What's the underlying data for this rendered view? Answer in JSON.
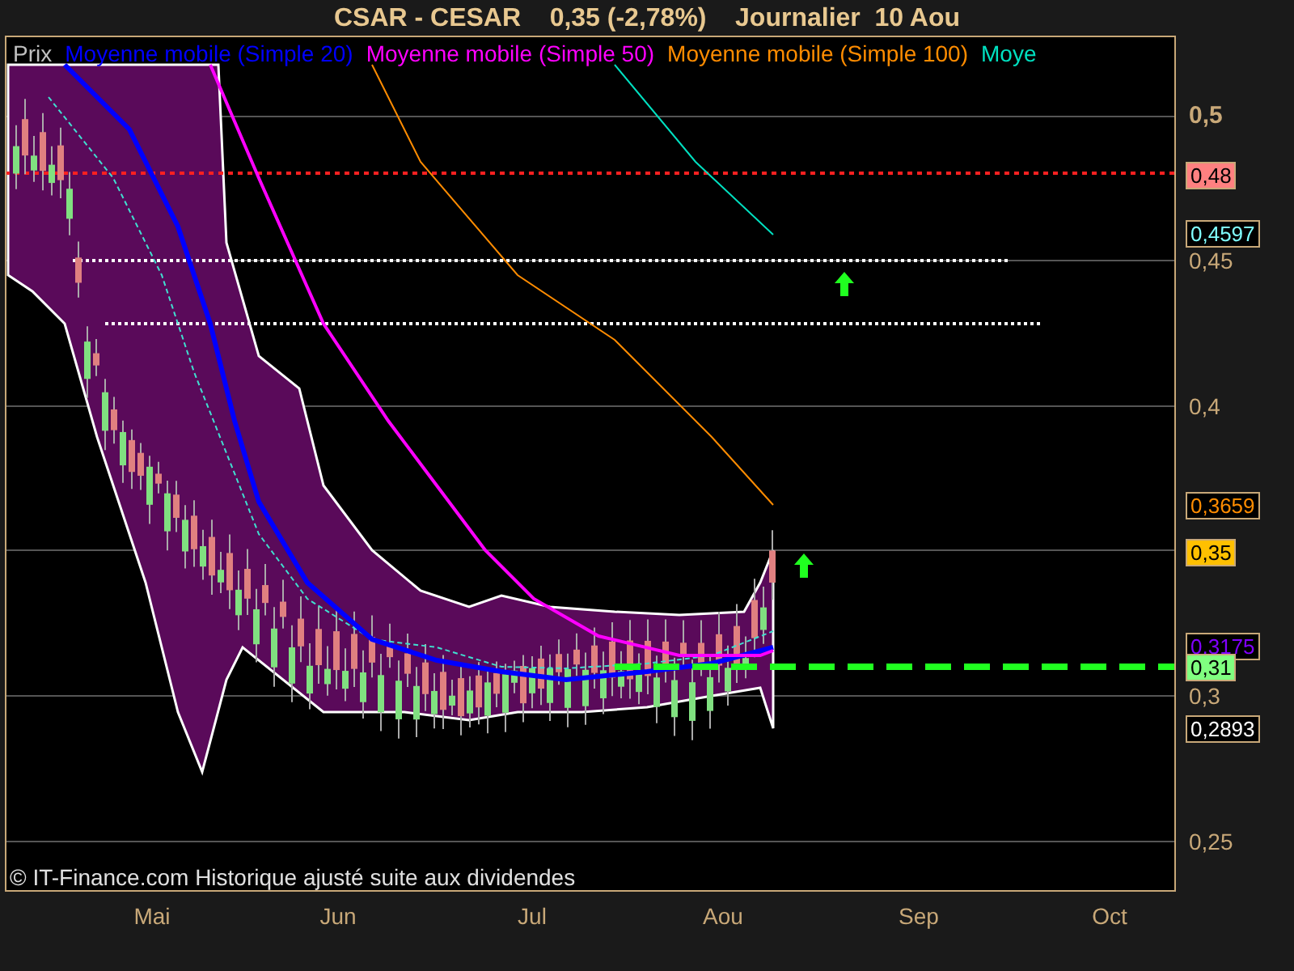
{
  "title": "CSAR - CESAR    0,35 (-2,78%)    Journalier  10 Aou",
  "legend": [
    {
      "label": "Prix",
      "color": "#c0c0c0"
    },
    {
      "label": "Moyenne mobile (Simple 20)",
      "color": "#0000ff"
    },
    {
      "label": "Moyenne mobile (Simple 50)",
      "color": "#ff00ff"
    },
    {
      "label": "Moyenne mobile (Simple 100)",
      "color": "#ff8c00"
    },
    {
      "label": "Moye",
      "color": "#00e0c0"
    }
  ],
  "y_axis": [
    {
      "label": "0,5",
      "emphasized": true
    },
    {
      "label": "0,45",
      "emphasized": false
    },
    {
      "label": "0,4",
      "emphasized": false
    },
    {
      "label": "0,3",
      "emphasized": false
    },
    {
      "label": "0,25",
      "emphasized": false
    }
  ],
  "price_tags": [
    {
      "label": "0,48",
      "kind": "filled",
      "color": "#ff8080"
    },
    {
      "label": "0,4597",
      "kind": "outlined",
      "color": "#80ffff"
    },
    {
      "label": "0,3659",
      "kind": "outlined",
      "color": "#ff8c00"
    },
    {
      "label": "0,35",
      "kind": "filled",
      "color": "#ffc000"
    },
    {
      "label": "0,3175",
      "kind": "outlined",
      "color": "#8000ff"
    },
    {
      "label": "0,31",
      "kind": "filled",
      "color": "#80ff80"
    },
    {
      "label": "0,2893",
      "kind": "outlined",
      "color": "#ffffff"
    }
  ],
  "x_axis": [
    "Mai",
    "Jun",
    "Jul",
    "Aou",
    "Sep",
    "Oct"
  ],
  "copyright": "© IT-Finance.com Historique ajusté suite aux dividendes"
}
